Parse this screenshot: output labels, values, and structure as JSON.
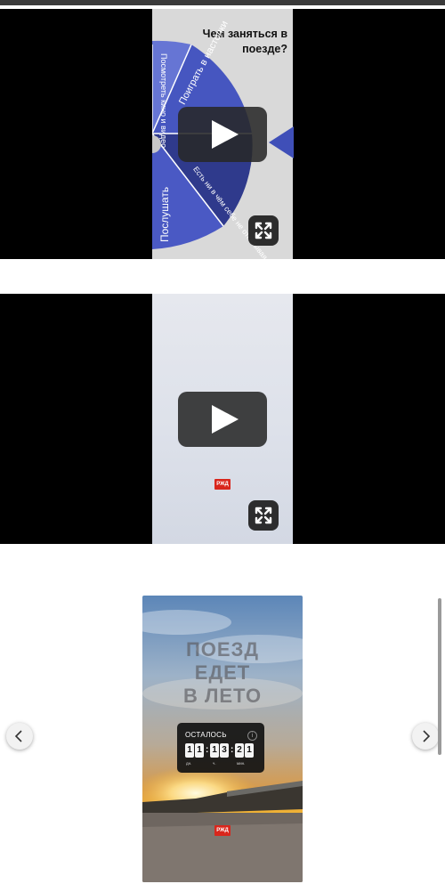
{
  "video1": {
    "title": "Чем заняться в поезде?",
    "segments": [
      "Поиграть в настолки",
      "Есть ни в чём себе не отказывая",
      "Послушать",
      "Посмотреть кино и видео"
    ],
    "play_icon": "play-icon",
    "fullscreen_icon": "fullscreen-icon"
  },
  "video2": {
    "logo": "РЖД",
    "play_icon": "play-icon",
    "fullscreen_icon": "fullscreen-icon"
  },
  "story": {
    "title_lines": [
      "ПОЕЗД",
      "ЕДЕТ",
      "В ЛЕТО"
    ],
    "timer_title": "ОСТАЛОСЬ",
    "timer_info": "i",
    "digits": [
      "1",
      "1",
      "1",
      "3",
      "2",
      "1"
    ],
    "units": [
      "дн.",
      "ч.",
      "мин."
    ],
    "logo": "РЖД"
  },
  "carousel": {
    "prev_icon": "chevron-left-icon",
    "next_icon": "chevron-right-icon"
  },
  "colors": {
    "brand_red": "#d9261c",
    "wheel_blue": "#3f4fb8"
  }
}
